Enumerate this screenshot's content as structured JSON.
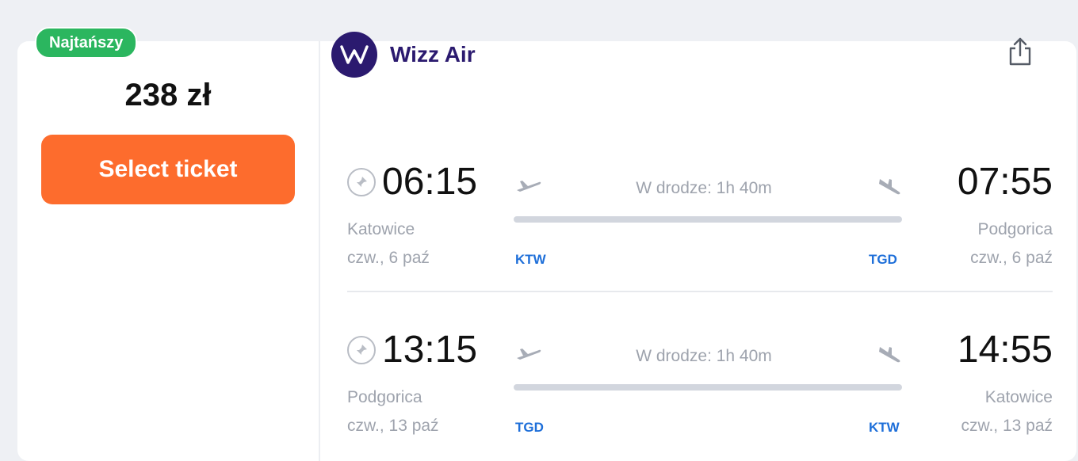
{
  "badge": {
    "label": "Najtańszy"
  },
  "price": {
    "amount": "238 zł"
  },
  "action": {
    "select_label": "Select ticket"
  },
  "airline": {
    "name": "Wizz Air",
    "logo_icon": "wizz-air-logo",
    "brand_color": "#2b1a6f"
  },
  "share": {
    "icon": "share-icon"
  },
  "legs": [
    {
      "departure_time": "06:15",
      "arrival_time": "07:55",
      "duration": "W drodze: 1h 40m",
      "from_city": "Katowice",
      "from_date": "czw., 6 paź",
      "to_city": "Podgorica",
      "to_date": "czw., 6 paź",
      "from_code": "KTW",
      "to_code": "TGD"
    },
    {
      "departure_time": "13:15",
      "arrival_time": "14:55",
      "duration": "W drodze: 1h 40m",
      "from_city": "Podgorica",
      "from_date": "czw., 13 paź",
      "to_city": "Katowice",
      "to_date": "czw., 13 paź",
      "from_code": "TGD",
      "to_code": "KTW"
    }
  ],
  "colors": {
    "badge_green": "#2bb65f",
    "button_orange": "#fd6c2d",
    "code_blue": "#1e6fd9",
    "muted_text": "#9ea3ad"
  }
}
